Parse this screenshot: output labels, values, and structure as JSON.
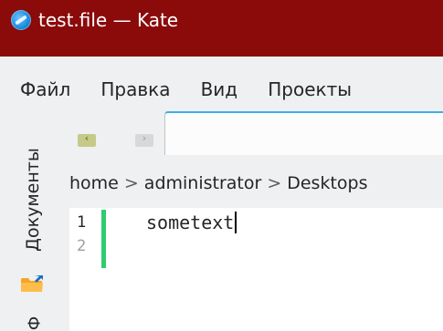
{
  "window": {
    "title": "test.file  — Kate",
    "app_icon": "kate-icon"
  },
  "menubar": {
    "items": [
      "Файл",
      "Правка",
      "Вид",
      "Проекты"
    ]
  },
  "side_panel": {
    "documents_tab_label": "Документы",
    "second_tab_label": "Ф"
  },
  "navigation": {
    "back_glyph": "‹",
    "forward_glyph": "›"
  },
  "breadcrumb": {
    "items": [
      "home",
      "administrator",
      "Desktops"
    ],
    "separator": ">"
  },
  "editor": {
    "line_numbers": [
      "1",
      "2"
    ],
    "lines": [
      "sometext"
    ]
  },
  "colors": {
    "titlebar": "#8b0a0a",
    "accent": "#3daee9",
    "modified_marker": "#2ecc71"
  }
}
